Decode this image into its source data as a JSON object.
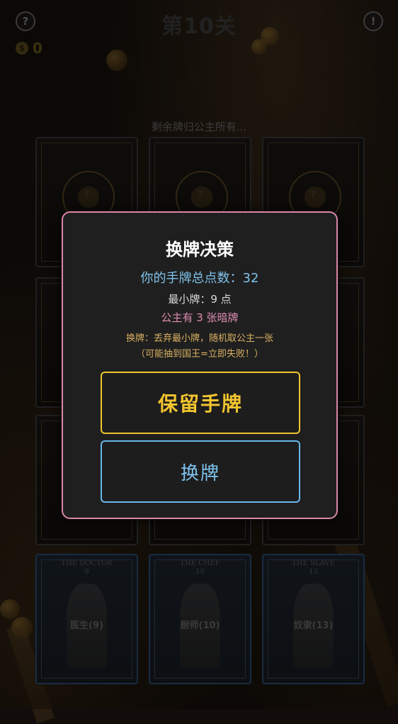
{
  "header": {
    "help_icon": "?",
    "title": "第10关",
    "alert_icon": "!",
    "coin_symbol": "$",
    "coins": "0"
  },
  "status_text": "剩余牌归公主所有...",
  "hand_cards": [
    {
      "title": "THE DOCTOR",
      "number": "9",
      "name": "医生(9)"
    },
    {
      "title": "THE CHEF",
      "number": "10",
      "name": "厨师(10)"
    },
    {
      "title": "THE SLAVE",
      "number": "13",
      "name": "奴隶(13)"
    }
  ],
  "hidden_card_mark": "?",
  "modal": {
    "title": "换牌决策",
    "total": "你的手牌总点数：32",
    "min_card": "最小牌：9 点",
    "princess_dark": "公主有 3 张暗牌",
    "desc_line1": "换牌：丢弃最小牌，随机取公主一张",
    "desc_line2": "（可能抽到国王=立即失败！）",
    "keep_button": "保留手牌",
    "swap_button": "换牌"
  },
  "colors": {
    "modal_border": "#d987a8",
    "keep_accent": "#eec52d",
    "swap_accent": "#66b8ea",
    "total_text": "#7fc1ea",
    "dark_text": "#de8db0",
    "desc_text": "#d8b062"
  }
}
